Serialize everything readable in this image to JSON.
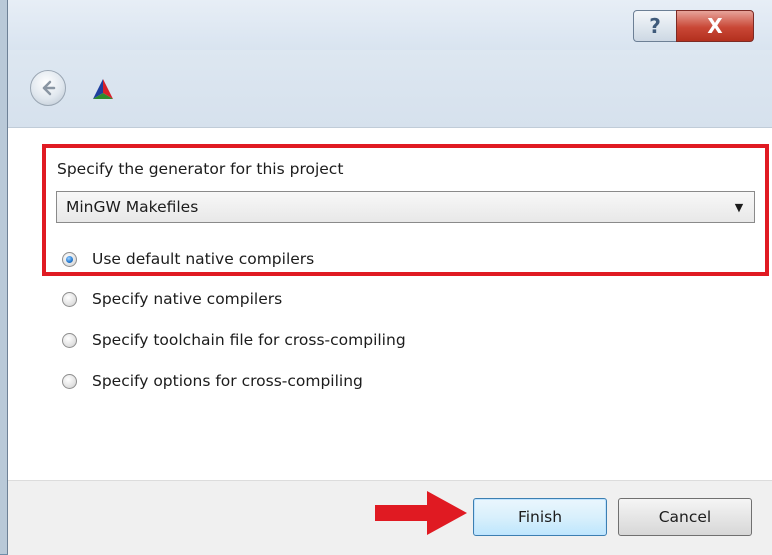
{
  "window": {
    "help_label": "?",
    "close_label": "X"
  },
  "section": {
    "label": "Specify the generator for this project"
  },
  "generator": {
    "selected": "MinGW Makefiles",
    "arrow": "▼"
  },
  "options": [
    {
      "label": "Use default native compilers",
      "checked": true
    },
    {
      "label": "Specify native compilers",
      "checked": false
    },
    {
      "label": "Specify toolchain file for cross-compiling",
      "checked": false
    },
    {
      "label": "Specify options for cross-compiling",
      "checked": false
    }
  ],
  "buttons": {
    "finish": "Finish",
    "cancel": "Cancel"
  },
  "colors": {
    "highlight": "#e01a22",
    "arrow": "#e01a22",
    "radio_checked": "#2a7fd5"
  }
}
